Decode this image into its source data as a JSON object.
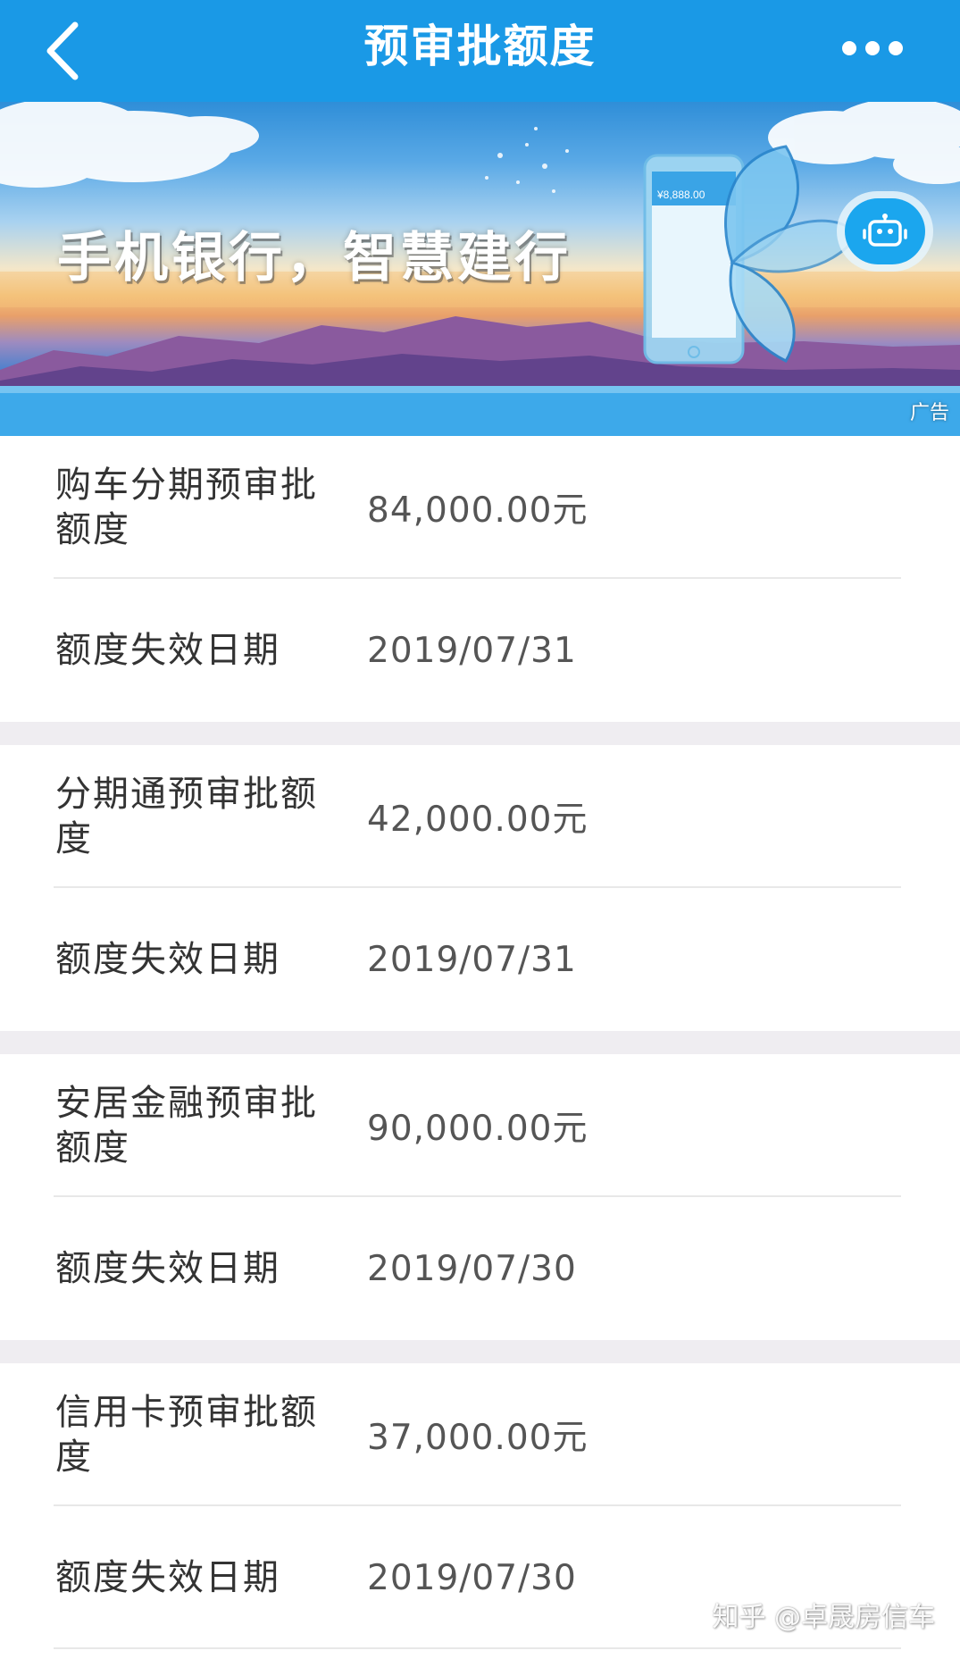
{
  "header": {
    "title": "预审批额度",
    "back_icon": "chevron-left-icon",
    "more_icon": "more-dots-icon",
    "background": "#1a99e6"
  },
  "banner": {
    "slogan": "手机银行，智慧建行",
    "ad_label": "广告",
    "phone_amount": "¥8,888.00",
    "robot_icon": "robot-icon"
  },
  "quotas": [
    {
      "label": "购车分期预审批额度",
      "amount": "84,000.00元",
      "expiry_label": "额度失效日期",
      "expiry_date": "2019/07/31"
    },
    {
      "label": "分期通预审批额度",
      "amount": "42,000.00元",
      "expiry_label": "额度失效日期",
      "expiry_date": "2019/07/31"
    },
    {
      "label": "安居金融预审批额度",
      "amount": "90,000.00元",
      "expiry_label": "额度失效日期",
      "expiry_date": "2019/07/30"
    },
    {
      "label": "信用卡预审批额度",
      "amount": "37,000.00元",
      "expiry_label": "额度失效日期",
      "expiry_date": "2019/07/30"
    }
  ],
  "watermark": "知乎 @卓晟房信车"
}
